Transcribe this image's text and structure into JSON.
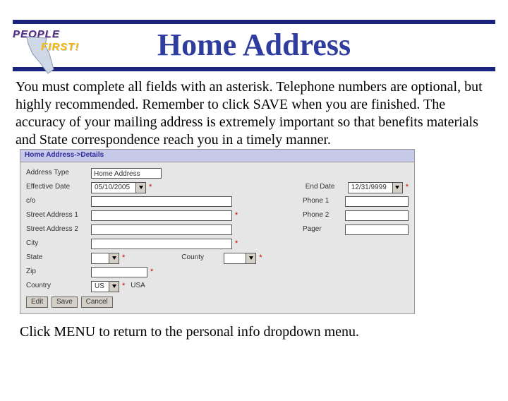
{
  "logo": {
    "line1": "PEOPLE",
    "line2": "FIRST!"
  },
  "title": "Home Address",
  "intro": "You must complete all fields with an asterisk.  Telephone numbers are optional, but highly recommended. Remember to click SAVE when you are finished. The accuracy of your mailing address is extremely important so that benefits materials and State correspondence reach you in a timely manner.",
  "panel": {
    "breadcrumb": "Home Address->Details",
    "labels": {
      "address_type": "Address Type",
      "effective_date": "Effective Date",
      "end_date": "End Date",
      "co": "c/o",
      "street1": "Street Address 1",
      "street2": "Street Address 2",
      "city": "City",
      "state": "State",
      "county": "County",
      "zip": "Zip",
      "country": "Country",
      "phone1": "Phone 1",
      "phone2": "Phone 2",
      "pager": "Pager"
    },
    "values": {
      "address_type": "Home Address",
      "effective_date": "05/10/2005",
      "end_date": "12/31/9999",
      "state": "",
      "county": "",
      "country_code": "US",
      "country_name": "USA"
    },
    "buttons": {
      "edit": "Edit",
      "save": "Save",
      "cancel": "Cancel"
    },
    "asterisk": "*"
  },
  "footer": "Click MENU to return to the personal info dropdown menu."
}
